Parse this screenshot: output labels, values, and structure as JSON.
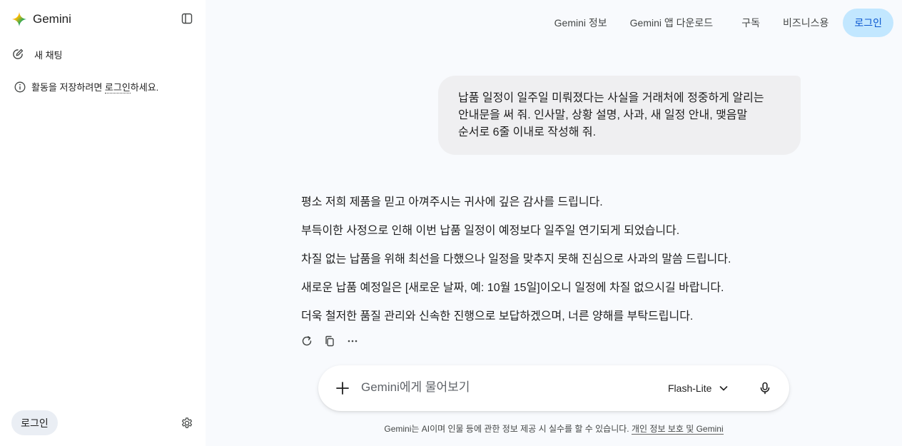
{
  "brand": {
    "name": "Gemini"
  },
  "sidebar": {
    "new_chat": "새 채팅",
    "info_prefix": "활동을 저장하려면 ",
    "info_link": "로그인",
    "info_suffix": "하세요.",
    "login": "로그인"
  },
  "topnav": {
    "about": "Gemini 정보",
    "download": "Gemini 앱 다운로드",
    "subscribe": "구독",
    "business": "비즈니스용",
    "login": "로그인"
  },
  "conversation": {
    "user_message": [
      "납품 일정이 일주일 미뤄졌다는 사실을 거래처에 정중하게 알리는",
      "안내문을 써 줘. 인사말, 상황 설명, 사과, 새 일정 안내, 맺음말",
      "순서로 6줄 이내로 작성해 줘."
    ],
    "response": [
      "평소 저희 제품을 믿고 아껴주시는 귀사에 깊은 감사를 드립니다.",
      "부득이한 사정으로 인해 이번 납품 일정이 예정보다 일주일 연기되게 되었습니다.",
      "차질 없는 납품을 위해 최선을 다했으나 일정을 맞추지 못해 진심으로 사과의 말씀 드립니다.",
      "새로운 납품 예정일은 [새로운 날짜, 예: 10월 15일]이오니 일정에 차질 없으시길 바랍니다.",
      "더욱 철저한 품질 관리와 신속한 진행으로 보답하겠으며, 너른 양해를 부탁드립니다."
    ]
  },
  "composer": {
    "placeholder": "Gemini에게 물어보기",
    "model": "Flash-Lite"
  },
  "disclaimer": {
    "text": "Gemini는 AI이며 인물 등에 관한 정보 제공 시 실수를 할 수 있습니다. ",
    "link": "개인 정보 보호 및 Gemini"
  },
  "icons": {
    "brand": "gemini-star-icon",
    "panel_toggle": "sidebar-toggle-icon",
    "new_chat": "edit-icon",
    "info": "info-icon",
    "settings": "gear-icon",
    "regenerate": "refresh-icon",
    "copy": "copy-icon",
    "more": "more-icon",
    "add": "plus-icon",
    "model_dropdown": "chevron-down-icon",
    "mic": "microphone-icon"
  },
  "colors": {
    "accent": "#0b57d0",
    "login_bg": "#c2e7ff",
    "bubble_bg": "#efeff1",
    "page_bg": "#f8fafd"
  }
}
